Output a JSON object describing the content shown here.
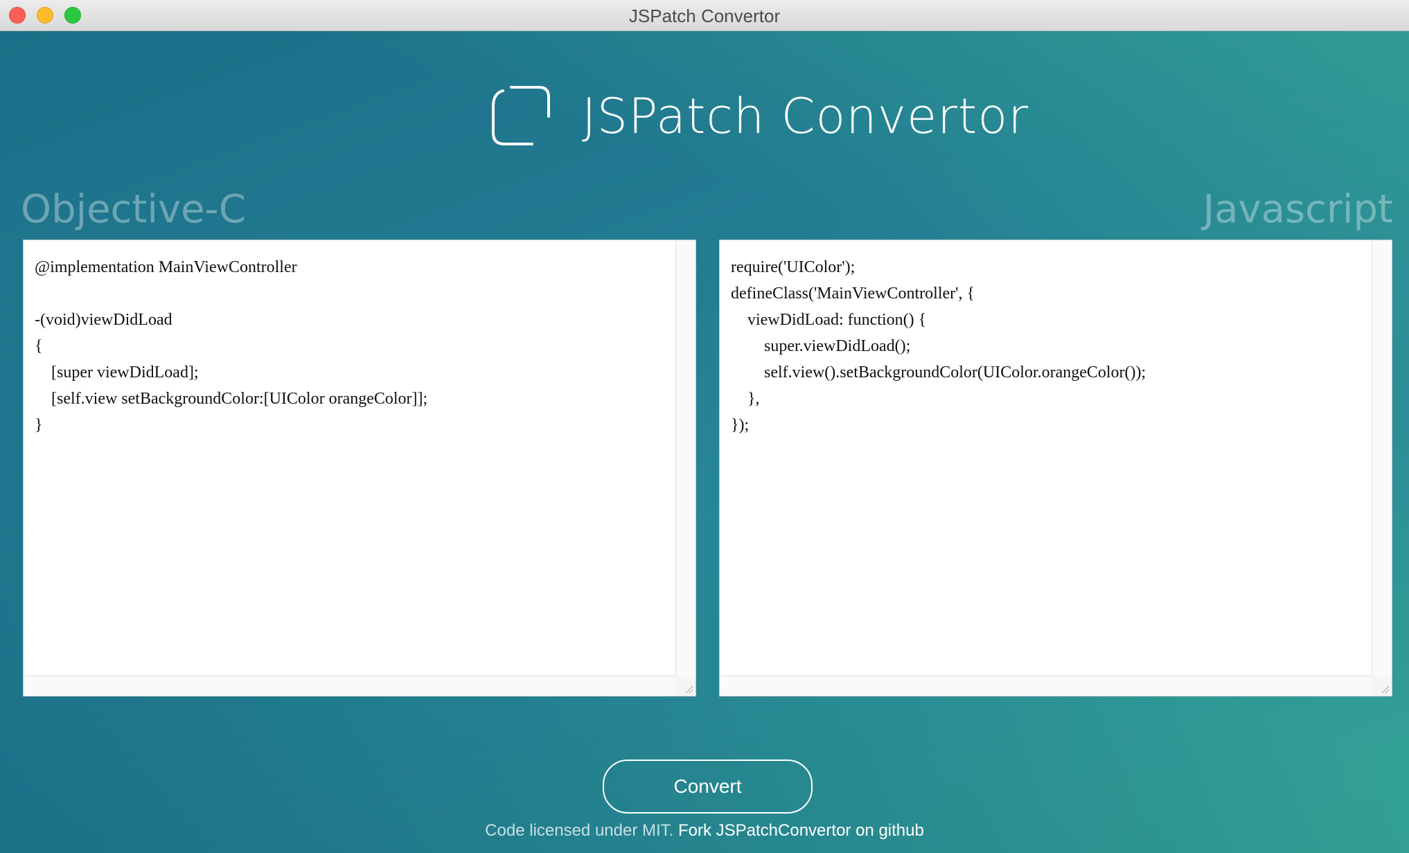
{
  "window": {
    "title": "JSPatch Convertor"
  },
  "header": {
    "app_title": "JSPatch Convertor",
    "logo_icon": "rounded-square-logo-icon"
  },
  "editors": {
    "left": {
      "label": "Objective-C",
      "code": "@implementation MainViewController\n\n-(void)viewDidLoad\n{\n    [super viewDidLoad];\n    [self.view setBackgroundColor:[UIColor orangeColor]];\n}"
    },
    "right": {
      "label": "Javascript",
      "code": "require('UIColor');\ndefineClass('MainViewController', {\n    viewDidLoad: function() {\n        super.viewDidLoad();\n        self.view().setBackgroundColor(UIColor.orangeColor());\n    },\n});"
    }
  },
  "actions": {
    "convert_label": "Convert"
  },
  "footer": {
    "license_text": "Code licensed under MIT. ",
    "fork_link_text": "Fork JSPatchConvertor on github"
  },
  "colors": {
    "background_start": "#1b6f88",
    "background_end": "#35a594",
    "close": "#fc5f57",
    "minimize": "#fdbc2e",
    "maximize": "#28c840"
  }
}
